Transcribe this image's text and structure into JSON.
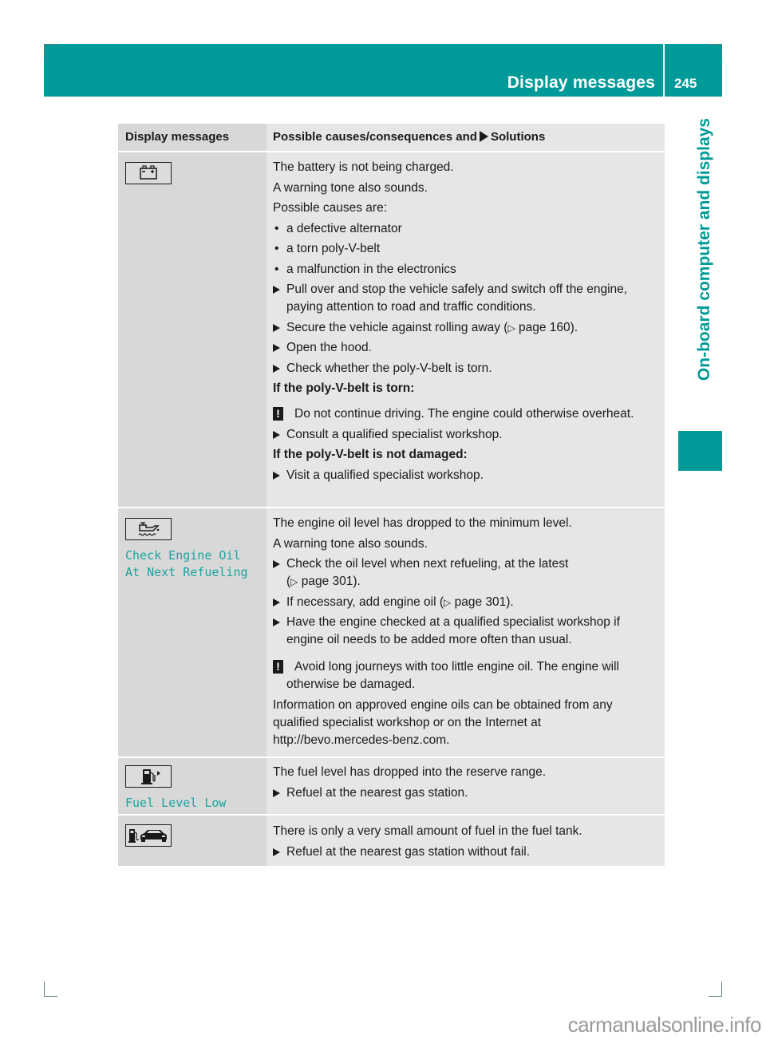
{
  "header": {
    "title": "Display messages",
    "page_number": "245"
  },
  "side_tab": {
    "label": "On-board computer and displays"
  },
  "table": {
    "col_display": "Display messages",
    "col_causes_prefix": "Possible causes/consequences and",
    "col_causes_suffix": "Solutions",
    "rows": [
      {
        "icon": "battery-icon",
        "display_lines": [],
        "content": {
          "p1": "The battery is not being charged.",
          "p2": "A warning tone also sounds.",
          "p3": "Possible causes are:",
          "bullets": [
            "a defective alternator",
            "a torn poly-V-belt",
            "a malfunction in the electronics"
          ],
          "steps": [
            "Pull over and stop the vehicle safely and switch off the engine, paying attention to road and traffic conditions.",
            "Secure the vehicle against rolling away (",
            "Open the hood.",
            "Check whether the poly-V-belt is torn."
          ],
          "step2_ref": "page 160",
          "step2_end": ").",
          "heading_torn": "If the poly-V-belt is torn:",
          "warning_torn": "Do not continue driving. The engine could otherwise overheat.",
          "step_torn": "Consult a qualified specialist workshop.",
          "heading_not_damaged": "If the poly-V-belt is not damaged:",
          "step_not_damaged": "Visit a qualified specialist workshop."
        }
      },
      {
        "icon": "engine-oil-icon",
        "display_lines": [
          "Check Engine Oil",
          "At Next Refueling"
        ],
        "content": {
          "p1": "The engine oil level has dropped to the minimum level.",
          "p2": "A warning tone also sounds.",
          "step1": "Check the oil level when next refueling, at the latest",
          "step1_ref": "page 301",
          "step2": "If necessary, add engine oil (",
          "step2_ref": "page 301",
          "step3": "Have the engine checked at a qualified specialist workshop if engine oil needs to be added more often than usual.",
          "warning": "Avoid long journeys with too little engine oil. The engine will otherwise be damaged.",
          "info": "Information on approved engine oils can be obtained from any qualified specialist workshop or on the Internet at http://bevo.mercedes-benz.com."
        }
      },
      {
        "icon": "fuel-pump-icon",
        "display_lines": [
          "Fuel Level Low"
        ],
        "content": {
          "p1": "The fuel level has dropped into the reserve range.",
          "step1": "Refuel at the nearest gas station."
        }
      },
      {
        "icon": "fuel-car-icon",
        "display_lines": [],
        "content": {
          "p1": "There is only a very small amount of fuel in the fuel tank.",
          "step1": "Refuel at the nearest gas station without fail."
        }
      }
    ]
  },
  "watermark": "carmanualsonline.info",
  "colors": {
    "brand_teal": "#009a98",
    "display_text": "#1aa3a0"
  }
}
